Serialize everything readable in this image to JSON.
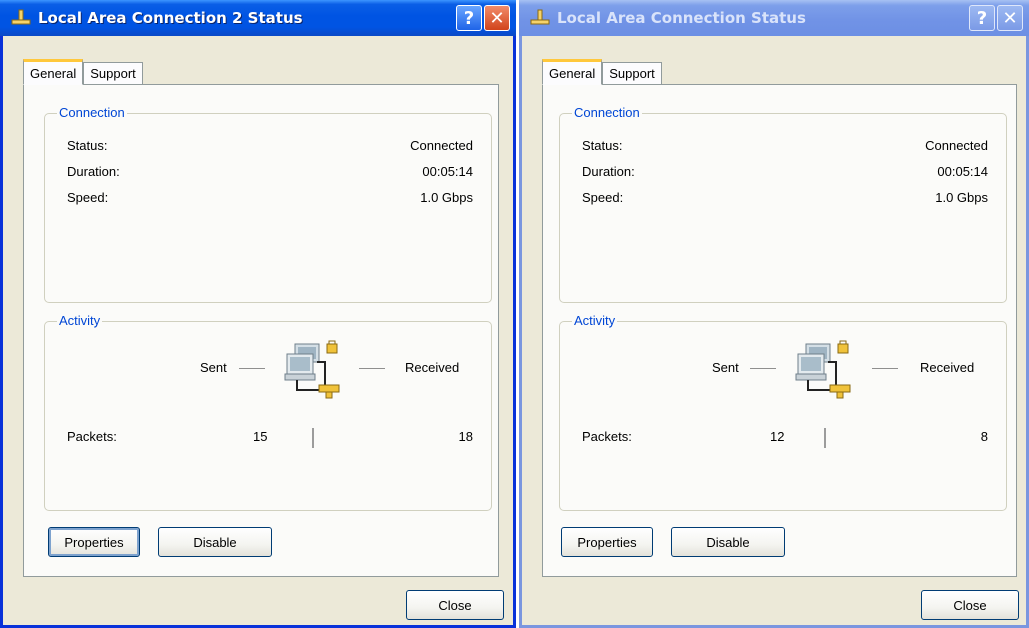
{
  "windows": [
    {
      "title": "Local Area Connection 2 Status",
      "tabs": [
        "General",
        "Support"
      ],
      "connection": {
        "legend": "Connection",
        "status_label": "Status:",
        "status_value": "Connected",
        "duration_label": "Duration:",
        "duration_value": "00:05:14",
        "speed_label": "Speed:",
        "speed_value": "1.0 Gbps"
      },
      "activity": {
        "legend": "Activity",
        "sent_label": "Sent",
        "received_label": "Received",
        "packets_label": "Packets:",
        "packets_sent": "15",
        "packets_received": "18"
      },
      "buttons": {
        "properties": "Properties",
        "disable": "Disable",
        "close": "Close"
      }
    },
    {
      "title": "Local Area Connection Status",
      "tabs": [
        "General",
        "Support"
      ],
      "connection": {
        "legend": "Connection",
        "status_label": "Status:",
        "status_value": "Connected",
        "duration_label": "Duration:",
        "duration_value": "00:05:14",
        "speed_label": "Speed:",
        "speed_value": "1.0 Gbps"
      },
      "activity": {
        "legend": "Activity",
        "sent_label": "Sent",
        "received_label": "Received",
        "packets_label": "Packets:",
        "packets_sent": "12",
        "packets_received": "8"
      },
      "buttons": {
        "properties": "Properties",
        "disable": "Disable",
        "close": "Close"
      }
    }
  ],
  "titlebar_buttons": {
    "help": "?",
    "close": "✕"
  },
  "colors": {
    "active_titlebar": "#0054e3",
    "inactive_titlebar": "#7193e6",
    "group_legend": "#0046d5",
    "dialog_bg": "#ece9d8"
  },
  "icons": {
    "titlebar": "network-connection-icon",
    "activity": "network-computers-icon"
  }
}
